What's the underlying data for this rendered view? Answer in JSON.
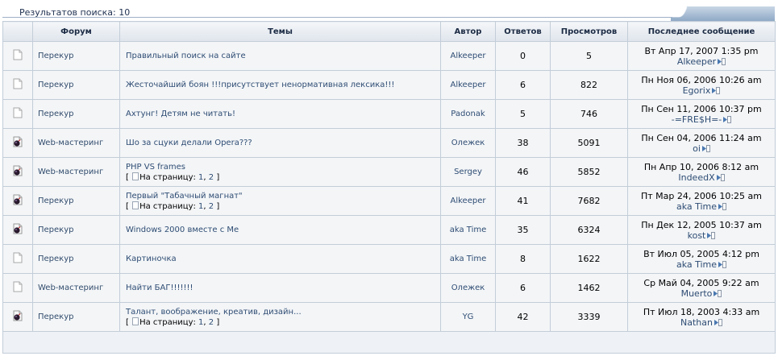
{
  "header": {
    "results_label": "Результатов поиска: 10"
  },
  "columns": {
    "forum": "Форум",
    "topics": "Темы",
    "author": "Автор",
    "replies": "Ответов",
    "views": "Просмотров",
    "last_post": "Последнее сообщение"
  },
  "colors": {
    "link": "#2f4d74",
    "row_bg": "#f3f5f7",
    "border": "#c3cdd8",
    "header_accent": "#8aa6c4"
  },
  "rows": [
    {
      "icon": "folder-icon",
      "forum": "Перекур",
      "topic": "Правильный поиск на сайте",
      "pages": null,
      "author": "Alkeeper",
      "replies": "0",
      "views": "5",
      "last_date": "Вт Апр 17, 2007 1:35 pm",
      "last_user": "Alkeeper"
    },
    {
      "icon": "folder-icon",
      "forum": "Перекур",
      "topic": "Жесточайший боян !!!присутствует ненормативная лексика!!!",
      "pages": null,
      "author": "Alkeeper",
      "replies": "6",
      "views": "822",
      "last_date": "Пн Ноя 06, 2006 10:26 am",
      "last_user": "Egorix"
    },
    {
      "icon": "folder-icon",
      "forum": "Перекур",
      "topic": "Ахтунг! Детям не читать!",
      "pages": null,
      "author": "Padonak",
      "replies": "5",
      "views": "746",
      "last_date": "Пн Сен 11, 2006 10:37 pm",
      "last_user": "-=FRE$H=-"
    },
    {
      "icon": "hot-folder-icon",
      "forum": "Web-мастеринг",
      "topic": "Шо за сцуки делали Opera???",
      "pages": null,
      "author": "Олежек",
      "replies": "38",
      "views": "5091",
      "last_date": "Пн Сен 04, 2006 11:24 am",
      "last_user": "oi"
    },
    {
      "icon": "hot-folder-icon",
      "forum": "Web-мастеринг",
      "topic": "PHP VS frames",
      "pages": {
        "label": "На страницу:",
        "p1": "1",
        "p2": "2"
      },
      "author": "Sergey",
      "replies": "46",
      "views": "5852",
      "last_date": "Пн Апр 10, 2006 8:12 am",
      "last_user": "IndeedX"
    },
    {
      "icon": "hot-folder-icon",
      "forum": "Перекур",
      "topic": "Первый \"Табачный магнат\"",
      "pages": {
        "label": "На страницу:",
        "p1": "1",
        "p2": "2"
      },
      "author": "Alkeeper",
      "replies": "41",
      "views": "7682",
      "last_date": "Пт Мар 24, 2006 10:25 am",
      "last_user": "aka Time"
    },
    {
      "icon": "hot-folder-icon",
      "forum": "Перекур",
      "topic": "Windows 2000 вместе с Me",
      "pages": null,
      "author": "aka Time",
      "replies": "35",
      "views": "6324",
      "last_date": "Пн Дек 12, 2005 10:37 am",
      "last_user": "kost"
    },
    {
      "icon": "folder-icon",
      "forum": "Перекур",
      "topic": "Картиночка",
      "pages": null,
      "author": "aka Time",
      "replies": "8",
      "views": "1622",
      "last_date": "Вт Июл 05, 2005 4:12 pm",
      "last_user": "aka Time"
    },
    {
      "icon": "folder-icon",
      "forum": "Web-мастеринг",
      "topic": "Найти БАГ!!!!!!!",
      "pages": null,
      "author": "Олежек",
      "replies": "6",
      "views": "1462",
      "last_date": "Ср Май 04, 2005 9:22 am",
      "last_user": "Muerto"
    },
    {
      "icon": "hot-folder-icon",
      "forum": "Перекур",
      "topic": "Талант, воображение, креатив, дизайн...",
      "pages": {
        "label": "На страницу:",
        "p1": "1",
        "p2": "2"
      },
      "author": "YG",
      "replies": "42",
      "views": "3339",
      "last_date": "Пт Июл 18, 2003 4:33 am",
      "last_user": "Nathan"
    }
  ]
}
